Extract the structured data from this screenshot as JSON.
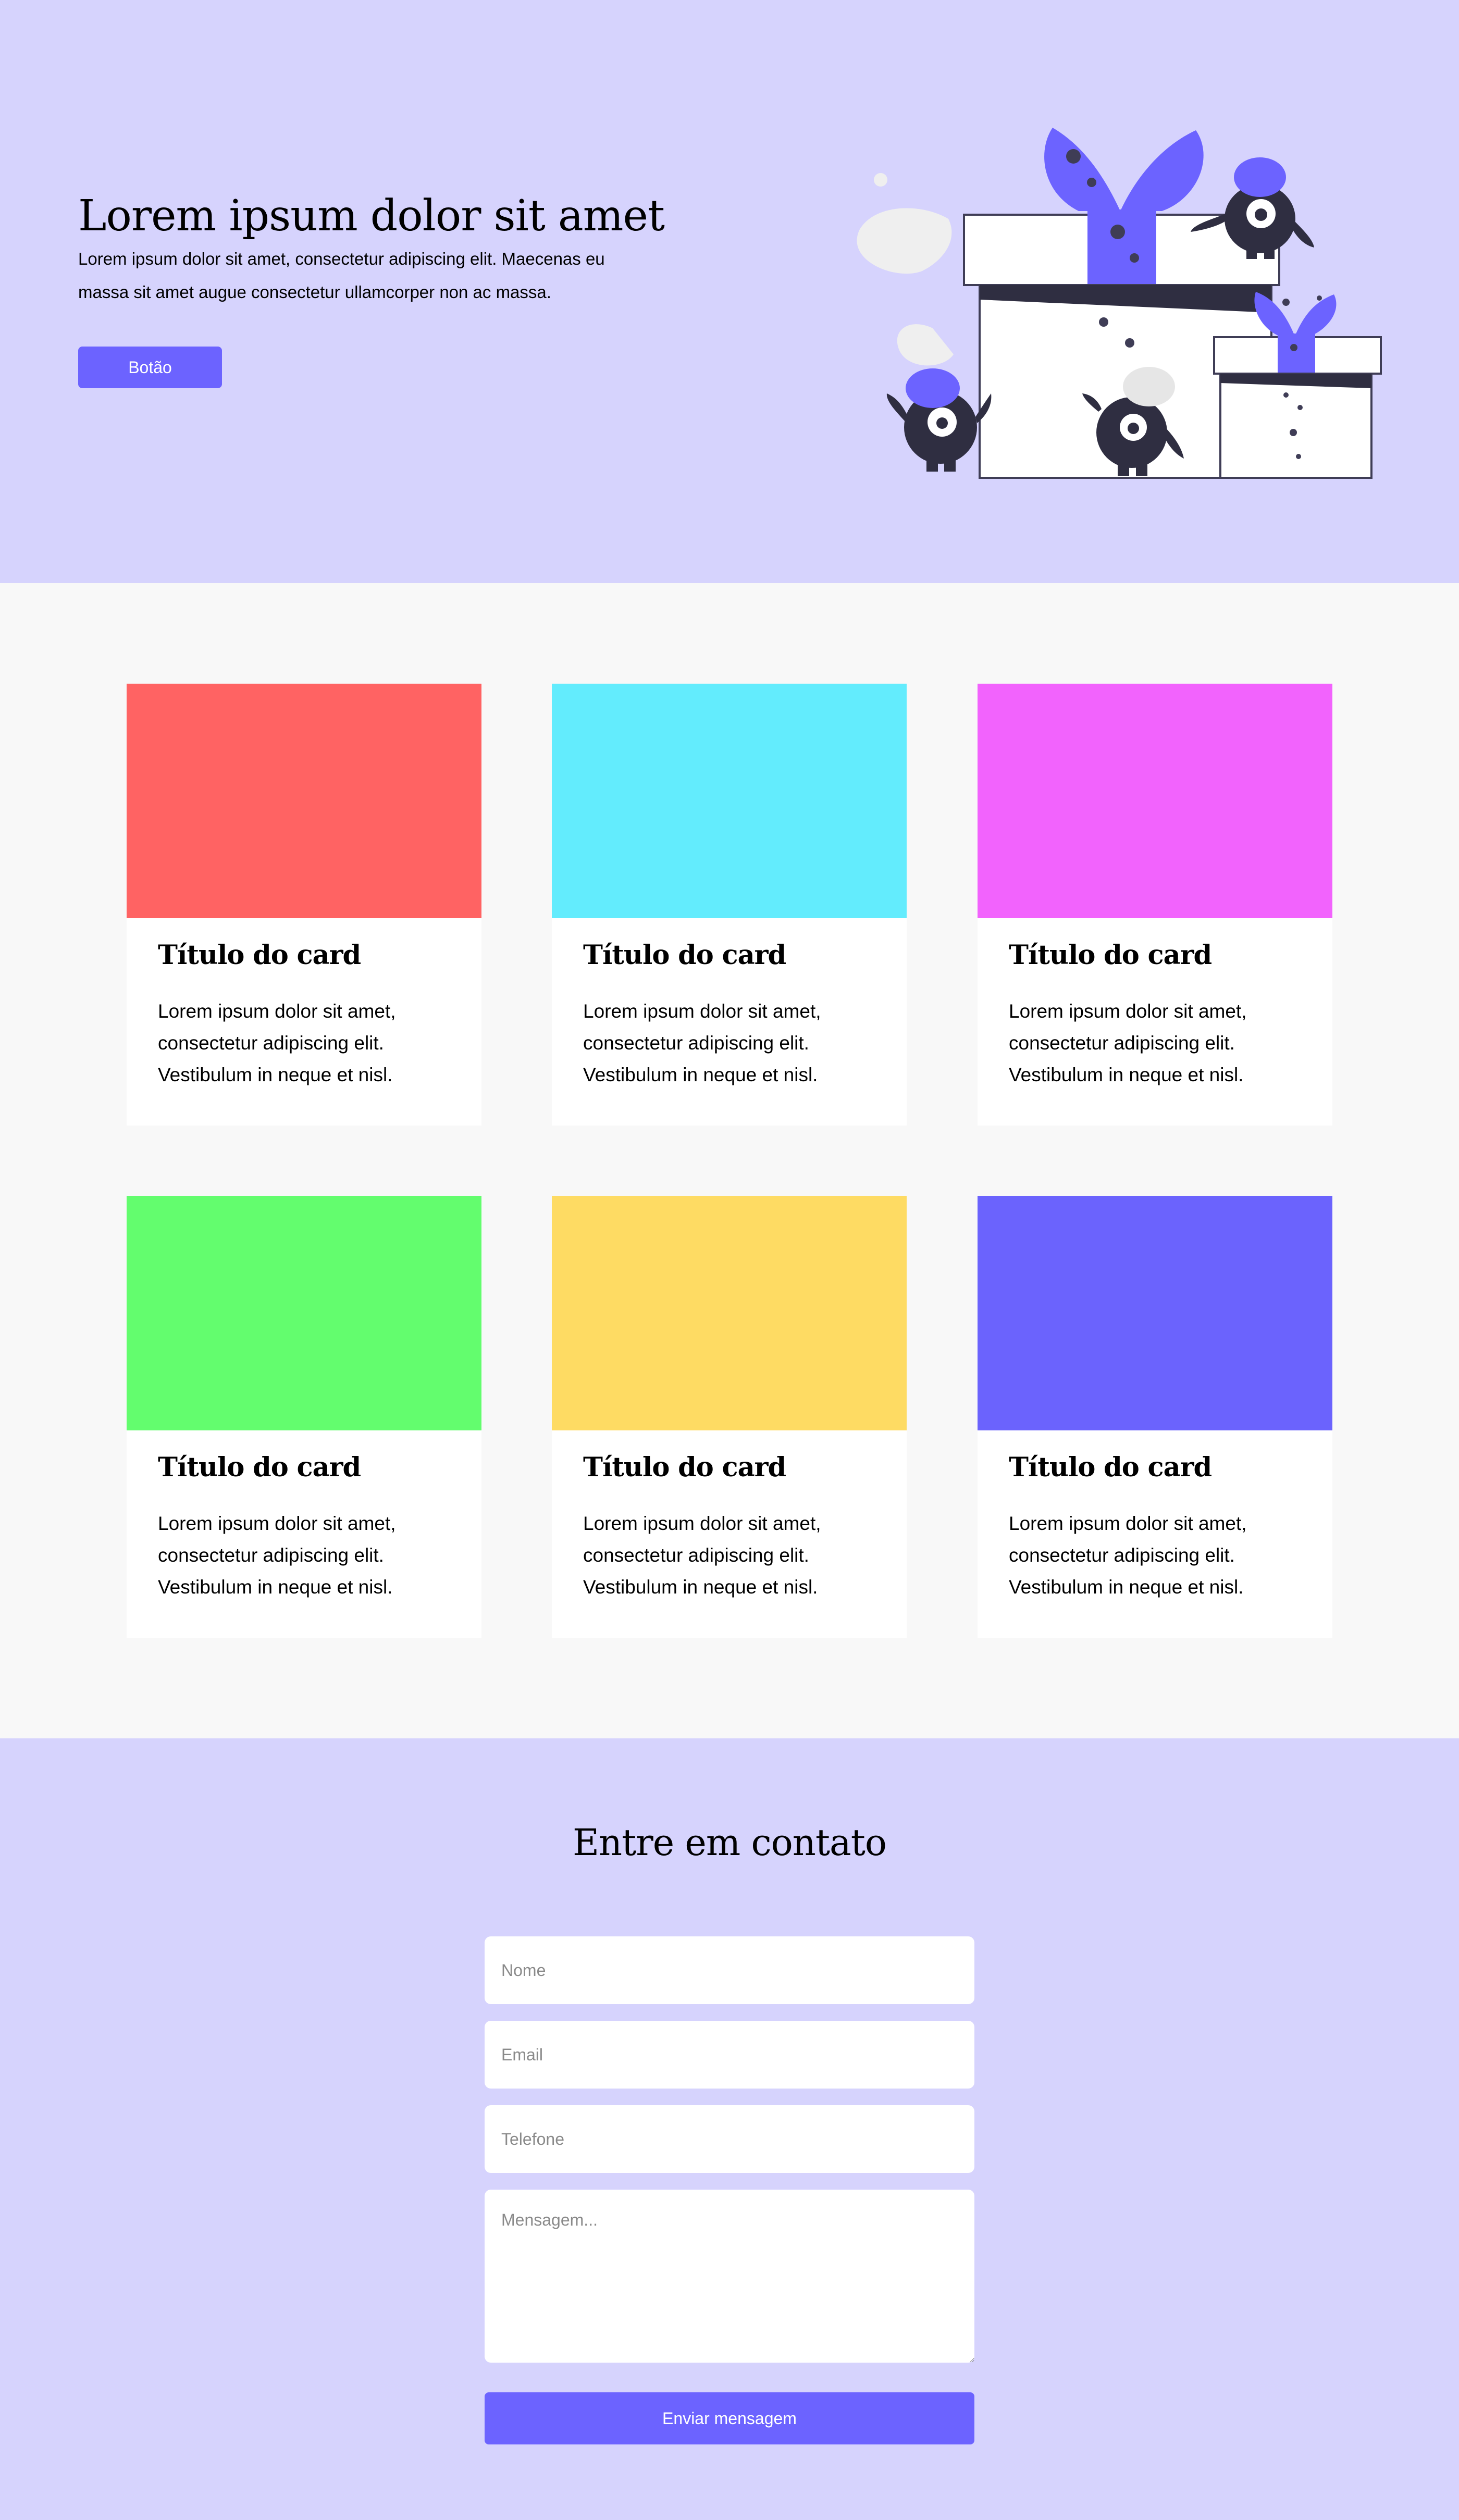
{
  "hero": {
    "title": "Lorem ipsum dolor sit amet",
    "text": "Lorem ipsum dolor sit amet, consectetur adipiscing elit. Maecenas eu massa sit amet augue consectetur ullamcorper non ac massa.",
    "button_label": "Botão",
    "illustration_icon": "gift-boxes-with-creatures-illustration"
  },
  "cards": [
    {
      "title": "Título do card",
      "text": "Lorem ipsum dolor sit amet, consectetur adipiscing elit. Vestibulum in neque et nisl.",
      "color": "#ff6363"
    },
    {
      "title": "Título do card",
      "text": "Lorem ipsum dolor sit amet, consectetur adipiscing elit. Vestibulum in neque et nisl.",
      "color": "#63ecfd"
    },
    {
      "title": "Título do card",
      "text": "Lorem ipsum dolor sit amet, consectetur adipiscing elit. Vestibulum in neque et nisl.",
      "color": "#f263fd"
    },
    {
      "title": "Título do card",
      "text": "Lorem ipsum dolor sit amet, consectetur adipiscing elit. Vestibulum in neque et nisl.",
      "color": "#63fd6e"
    },
    {
      "title": "Título do card",
      "text": "Lorem ipsum dolor sit amet, consectetur adipiscing elit. Vestibulum in neque et nisl.",
      "color": "#fedb63"
    },
    {
      "title": "Título do card",
      "text": "Lorem ipsum dolor sit amet, consectetur adipiscing elit. Vestibulum in neque et nisl.",
      "color": "#6b63fd"
    }
  ],
  "contact": {
    "title": "Entre em contato",
    "name_placeholder": "Nome",
    "email_placeholder": "Email",
    "phone_placeholder": "Telefone",
    "message_placeholder": "Mensagem...",
    "submit_label": "Enviar mensagem"
  },
  "colors": {
    "accent": "#6c63ff",
    "hero_background": "#d6d3fd",
    "section_background": "#f8f8f8"
  }
}
